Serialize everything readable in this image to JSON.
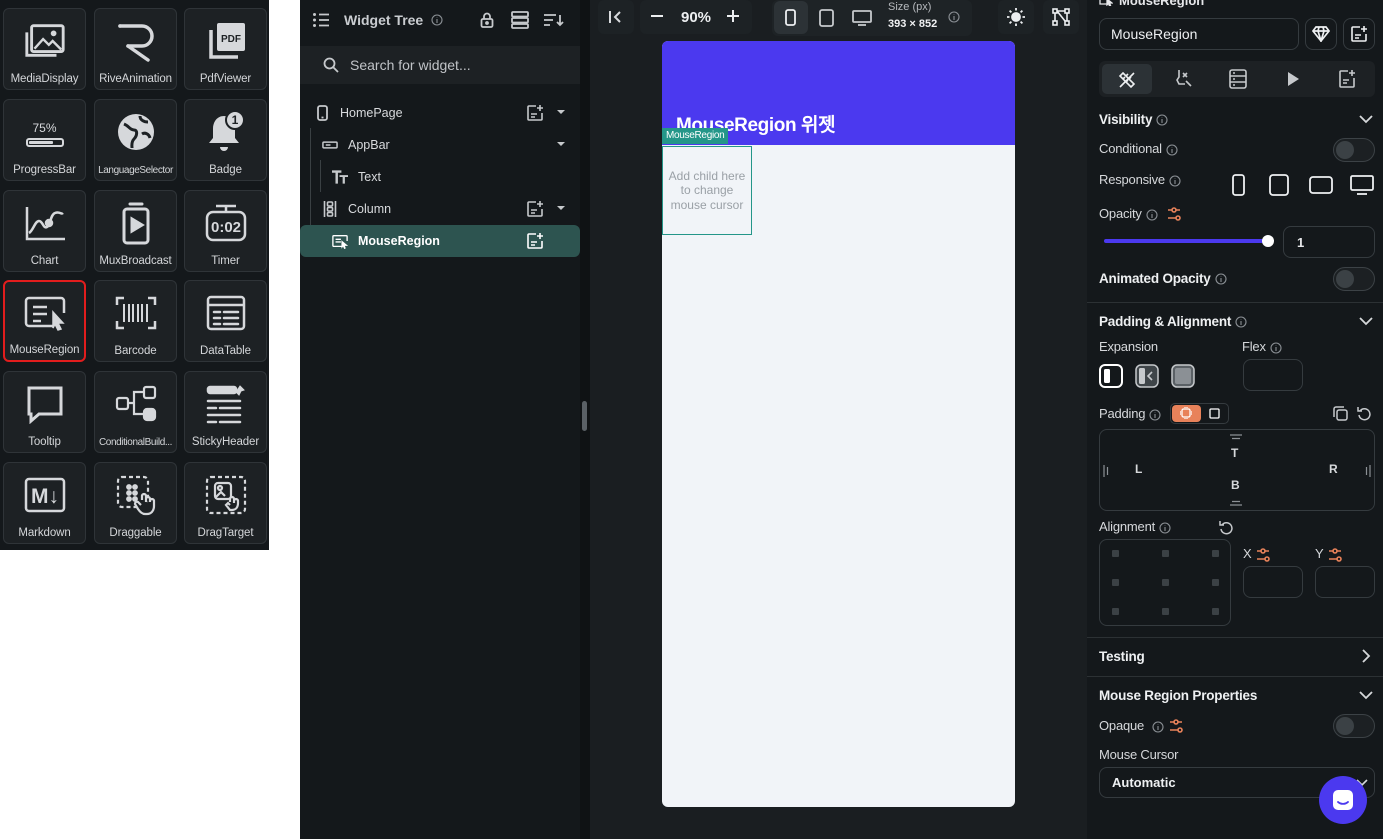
{
  "palette": {
    "tiles": [
      {
        "label": "MediaDisplay",
        "icon": "media-display-icon"
      },
      {
        "label": "RiveAnimation",
        "icon": "rive-icon"
      },
      {
        "label": "PdfViewer",
        "icon": "pdf-icon"
      },
      {
        "label": "ProgressBar",
        "icon": "progress-bar-icon",
        "progress_text": "75%",
        "progress": 0.75
      },
      {
        "label": "LanguageSelector",
        "icon": "globe-icon"
      },
      {
        "label": "Badge",
        "icon": "bell-badge-icon",
        "badge_count": "1"
      },
      {
        "label": "Chart",
        "icon": "chart-icon"
      },
      {
        "label": "MuxBroadcast",
        "icon": "mux-broadcast-icon"
      },
      {
        "label": "Timer",
        "icon": "timer-icon",
        "timer_text": "0:02"
      },
      {
        "label": "MouseRegion",
        "icon": "mouse-region-icon",
        "selected": true
      },
      {
        "label": "Barcode",
        "icon": "barcode-icon"
      },
      {
        "label": "DataTable",
        "icon": "data-table-icon"
      },
      {
        "label": "Tooltip",
        "icon": "tooltip-icon"
      },
      {
        "label": "ConditionalBuild...",
        "icon": "conditional-builder-icon"
      },
      {
        "label": "StickyHeader",
        "icon": "sticky-header-icon"
      },
      {
        "label": "Markdown",
        "icon": "markdown-icon",
        "md_text": "M↓"
      },
      {
        "label": "Draggable",
        "icon": "draggable-icon"
      },
      {
        "label": "DragTarget",
        "icon": "drag-target-icon"
      }
    ]
  },
  "tree": {
    "title": "Widget Tree",
    "search_placeholder": "Search for widget...",
    "nodes": [
      {
        "label": "HomePage",
        "icon": "phone-icon"
      },
      {
        "label": "AppBar",
        "icon": "appbar-icon"
      },
      {
        "label": "Text",
        "icon": "text-icon"
      },
      {
        "label": "Column",
        "icon": "column-icon"
      },
      {
        "label": "MouseRegion",
        "icon": "mouse-region-icon",
        "selected": true
      }
    ]
  },
  "canvas": {
    "zoom": "90%",
    "size_label": "Size (px)",
    "size_value": "393 × 852",
    "appbar_title": "MouseRegion 위젯",
    "appbar_color": "#4b39ef",
    "selected_tag": "MouseRegion",
    "placeholder": "Add child here to change mouse cursor",
    "accent": "#249689"
  },
  "props": {
    "header": "MouseRegion",
    "name_value": "MouseRegion",
    "visibility": {
      "title": "Visibility",
      "conditional": "Conditional",
      "responsive": "Responsive",
      "opacity": "Opacity",
      "opacity_value": "1",
      "animated_opacity": "Animated Opacity"
    },
    "padding_alignment": {
      "title": "Padding & Alignment",
      "expansion": "Expansion",
      "flex": "Flex",
      "padding": "Padding",
      "pad_t": "T",
      "pad_l": "L",
      "pad_r": "R",
      "pad_b": "B",
      "alignment": "Alignment",
      "x": "X",
      "y": "Y"
    },
    "testing": "Testing",
    "mouse_region": {
      "title": "Mouse Region Properties",
      "opaque": "Opaque",
      "cursor_label": "Mouse Cursor",
      "cursor_value": "Automatic"
    },
    "accent": "#e8825a"
  }
}
